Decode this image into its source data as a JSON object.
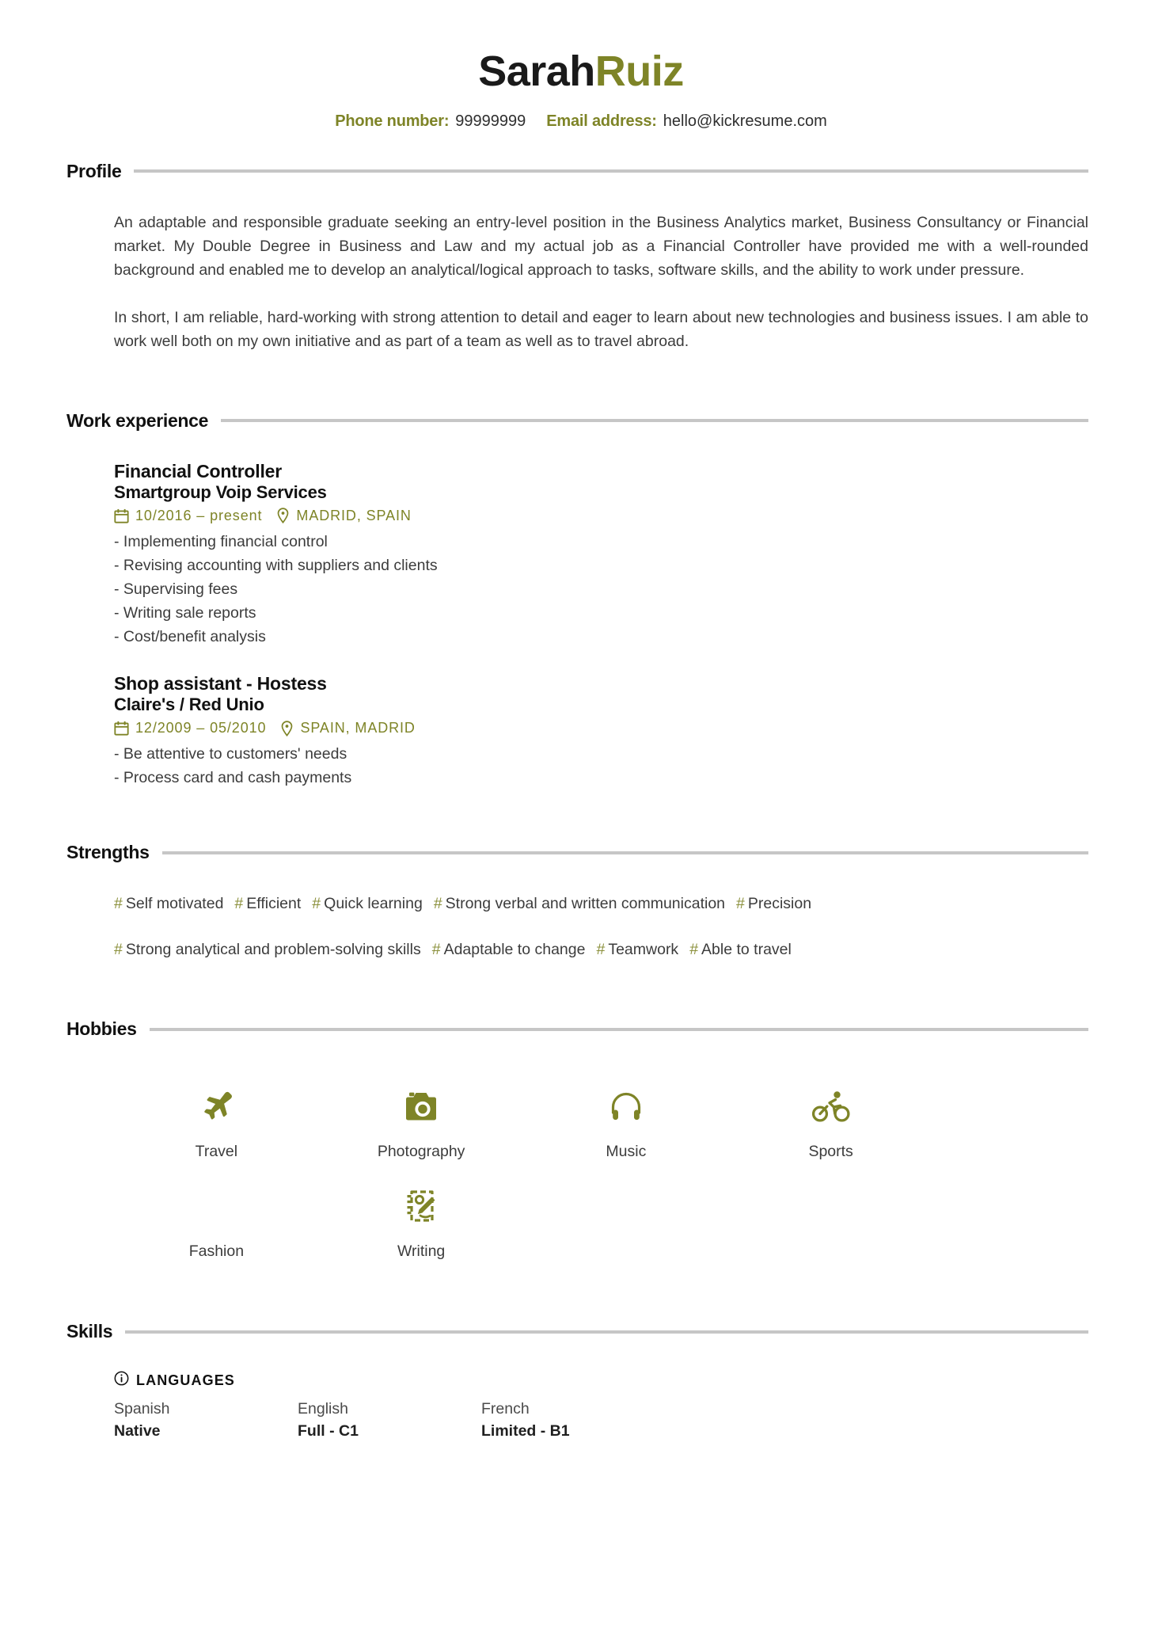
{
  "colors": {
    "accent": "#7e8427",
    "hash": "#8a8f3a",
    "heading": "#111111",
    "body": "#3c3c3c",
    "rule": "#c6c6c6"
  },
  "header": {
    "first_name": "Sarah",
    "last_name": "Ruiz",
    "phone_label": "Phone number:",
    "phone_value": "99999999",
    "email_label": "Email address:",
    "email_value": "hello@kickresume.com"
  },
  "sections": {
    "profile": {
      "title": "Profile",
      "paragraphs": [
        "An adaptable and responsible graduate seeking an entry-level position in the Business Analytics market, Business Consultancy or Financial market. My Double Degree in Business and Law and my actual job as a Financial Controller have provided me with a well-rounded background and enabled me to develop an analytical/logical approach to tasks, software skills, and the ability to work under pressure.",
        "In short, I am reliable, hard-working with strong attention to detail and eager to learn about new technologies and business issues. I am able to work well both on my own initiative and as part of a team as well as to travel abroad."
      ]
    },
    "work_experience": {
      "title": "Work experience",
      "jobs": [
        {
          "title": "Financial Controller",
          "company": "Smartgroup Voip Services",
          "dates": "10/2016 – present",
          "location": "MADRID, SPAIN",
          "bullets": [
            "- Implementing financial control",
            "- Revising accounting with suppliers and clients",
            "- Supervising fees",
            "- Writing sale reports",
            "- Cost/benefit analysis"
          ]
        },
        {
          "title": "Shop assistant - Hostess",
          "company": "Claire's / Red Unio",
          "dates": "12/2009 – 05/2010",
          "location": "SPAIN, MADRID",
          "bullets": [
            "- Be attentive to customers' needs",
            "- Process card and cash payments"
          ]
        }
      ]
    },
    "strengths": {
      "title": "Strengths",
      "rows": [
        [
          "Self motivated",
          "Efficient",
          "Quick learning",
          "Strong verbal and written communication",
          "Precision"
        ],
        [
          "Strong analytical and problem-solving skills",
          "Adaptable to change",
          "Teamwork",
          "Able to travel"
        ]
      ]
    },
    "hobbies": {
      "title": "Hobbies",
      "items": [
        {
          "label": "Travel",
          "icon": "plane-icon"
        },
        {
          "label": "Photography",
          "icon": "camera-icon"
        },
        {
          "label": "Music",
          "icon": "headphones-icon"
        },
        {
          "label": "Sports",
          "icon": "cyclist-icon"
        },
        {
          "label": "Fashion",
          "icon": "none"
        },
        {
          "label": "Writing",
          "icon": "notepad-pen-icon"
        }
      ]
    },
    "skills": {
      "title": "Skills",
      "group_label": "LANGUAGES",
      "group_icon": "info-circle-icon",
      "languages": [
        {
          "name": "Spanish",
          "level": "Native"
        },
        {
          "name": "English",
          "level": "Full - C1"
        },
        {
          "name": "French",
          "level": "Limited - B1"
        }
      ]
    }
  }
}
